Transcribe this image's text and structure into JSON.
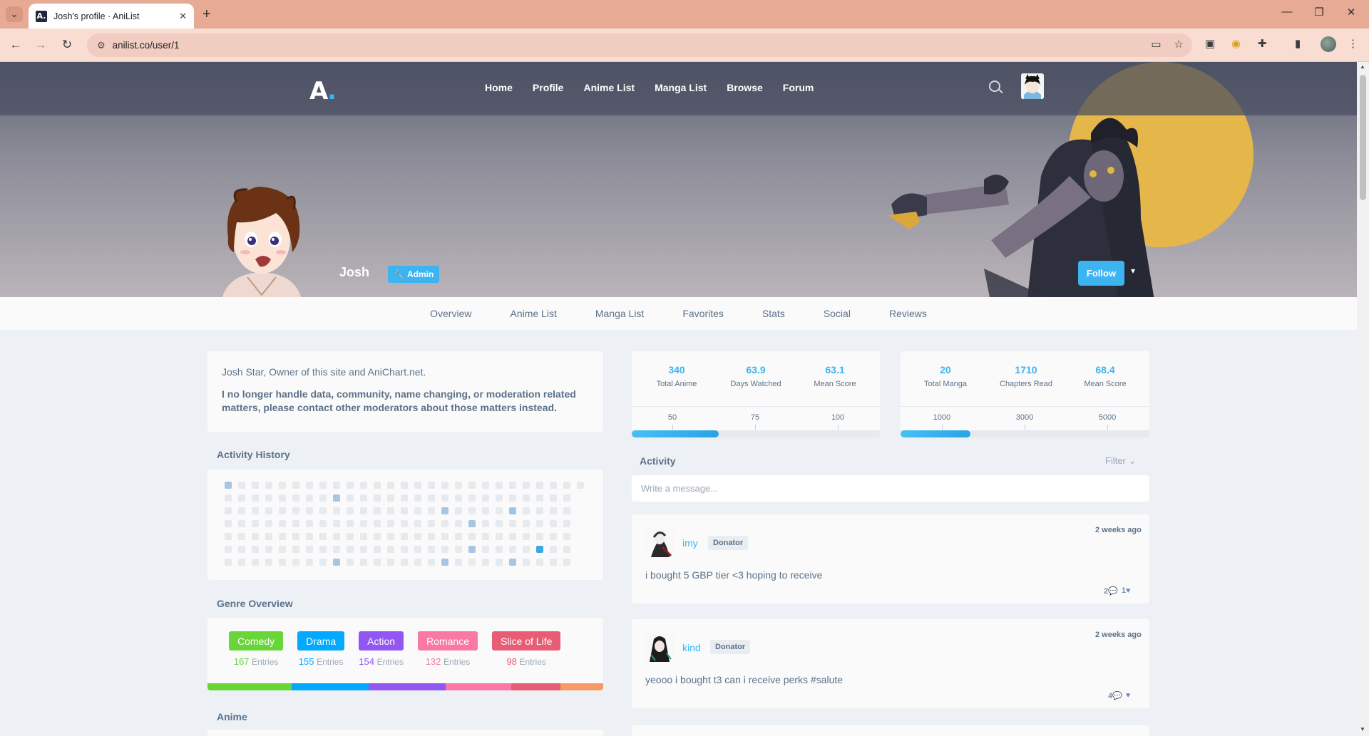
{
  "browser": {
    "tab_title": "Josh's profile · AniList",
    "favicon_text": "A.",
    "url": "anilist.co/user/1"
  },
  "site": {
    "logo": "A",
    "nav": [
      "Home",
      "Profile",
      "Anime List",
      "Manga List",
      "Browse",
      "Forum"
    ]
  },
  "profile": {
    "name": "Josh",
    "badge": "Admin",
    "follow_label": "Follow",
    "tabs": [
      "Overview",
      "Anime List",
      "Manga List",
      "Favorites",
      "Stats",
      "Social",
      "Reviews"
    ],
    "about": {
      "line1": "Josh Star, Owner of this site and AniChart.net.",
      "line2": "I no longer handle data, community, name changing, or moderation related matters, please contact other moderators about those matters instead."
    }
  },
  "sections": {
    "activity_history": "Activity History",
    "genre_overview": "Genre Overview",
    "anime": "Anime",
    "activity": "Activity",
    "filter": "Filter"
  },
  "genres": [
    {
      "name": "Comedy",
      "count": "167",
      "entries": "Entries",
      "color": "#68d639"
    },
    {
      "name": "Drama",
      "count": "155",
      "entries": "Entries",
      "color": "#02a9ff"
    },
    {
      "name": "Action",
      "count": "154",
      "entries": "Entries",
      "color": "#9256f3"
    },
    {
      "name": "Romance",
      "count": "132",
      "entries": "Entries",
      "color": "#f779a4"
    },
    {
      "name": "Slice of Life",
      "count": "98",
      "entries": "Entries",
      "color": "#e85d75"
    }
  ],
  "genre_bar_extra_color": "#f79a63",
  "anime_stats": {
    "total": "340",
    "total_label": "Total Anime",
    "days": "63.9",
    "days_label": "Days Watched",
    "mean": "63.1",
    "mean_label": "Mean Score",
    "scale": [
      "50",
      "75",
      "100"
    ],
    "progress": 0.35
  },
  "manga_stats": {
    "total": "20",
    "total_label": "Total Manga",
    "chapters": "1710",
    "chapters_label": "Chapters Read",
    "mean": "68.4",
    "mean_label": "Mean Score",
    "scale": [
      "1000",
      "3000",
      "5000"
    ],
    "progress": 0.28
  },
  "composer_placeholder": "Write a message...",
  "activities": [
    {
      "user": "imy",
      "badge": "Donator",
      "time": "2 weeks ago",
      "text": "i bought 5 GBP tier <3 hoping to receive",
      "replies": "2",
      "likes": "1"
    },
    {
      "user": "kind",
      "badge": "Donator",
      "time": "2 weeks ago",
      "text": "yeooo i bought t3 can i receive perks #salute",
      "replies": "4",
      "likes": ""
    }
  ],
  "heatmap_active": [
    {
      "col": 0,
      "row": 0,
      "level": 1
    },
    {
      "col": 8,
      "row": 1,
      "level": 1
    },
    {
      "col": 8,
      "row": 6,
      "level": 1
    },
    {
      "col": 16,
      "row": 2,
      "level": 1
    },
    {
      "col": 16,
      "row": 6,
      "level": 1
    },
    {
      "col": 18,
      "row": 3,
      "level": 1
    },
    {
      "col": 18,
      "row": 5,
      "level": 1
    },
    {
      "col": 21,
      "row": 6,
      "level": 1
    },
    {
      "col": 21,
      "row": 2,
      "level": 2
    },
    {
      "col": 23,
      "row": 5,
      "level": 3
    }
  ]
}
